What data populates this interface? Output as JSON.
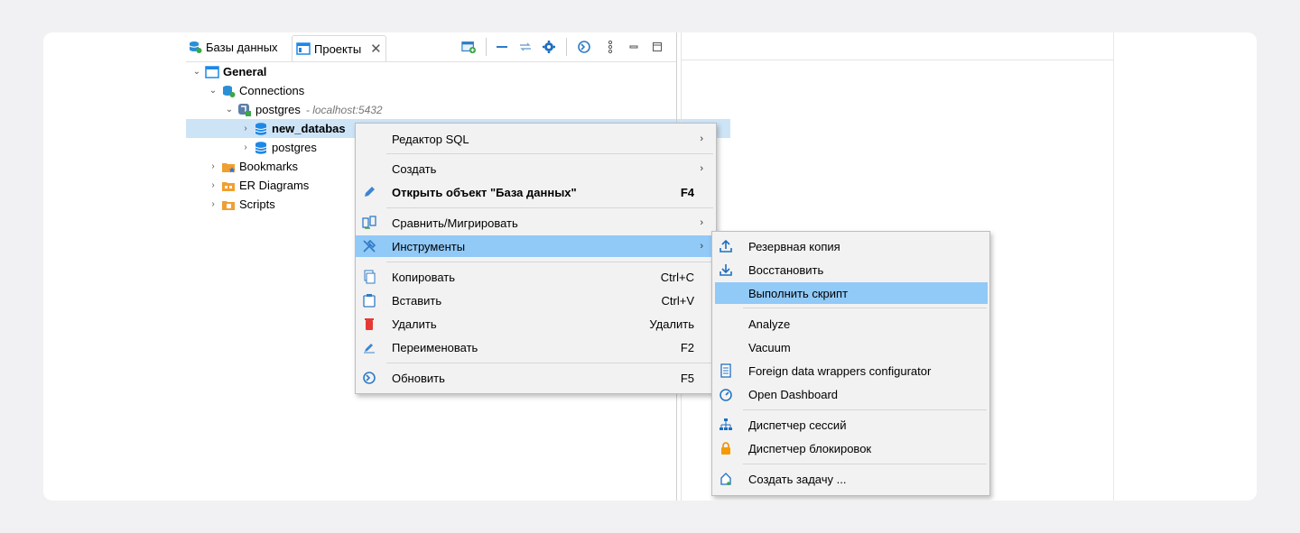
{
  "tabs": [
    {
      "label": "Базы данных",
      "icon": "database-stack-icon"
    },
    {
      "label": "Проекты",
      "icon": "projects-icon"
    }
  ],
  "toolbar": {
    "icons": [
      "new-project-icon",
      "collapse-icon",
      "link-icon",
      "settings-gear-icon",
      "refresh-icon",
      "vertical-dots-icon",
      "minimize-icon",
      "maximize-icon"
    ]
  },
  "tree": {
    "general": "General",
    "connections": "Connections",
    "postgres_conn": "postgres",
    "postgres_host": "- localhost:5432",
    "new_database": "new_databas",
    "postgres_db": "postgres",
    "bookmarks": "Bookmarks",
    "er_diagrams": "ER Diagrams",
    "scripts": "Scripts"
  },
  "context_menu": {
    "items": [
      {
        "label": "Редактор SQL",
        "shortcut": "",
        "submenu": true
      },
      {
        "label": "Создать",
        "shortcut": "",
        "submenu": true
      },
      {
        "label": "Открыть объект \"База данных\"",
        "shortcut": "F4",
        "submenu": false
      },
      {
        "label": "Сравнить/Мигрировать",
        "shortcut": "",
        "submenu": true
      },
      {
        "label": "Инструменты",
        "shortcut": "",
        "submenu": true
      },
      {
        "label": "Копировать",
        "shortcut": "Ctrl+C",
        "submenu": false
      },
      {
        "label": "Вставить",
        "shortcut": "Ctrl+V",
        "submenu": false
      },
      {
        "label": "Удалить",
        "shortcut": "Удалить",
        "submenu": false
      },
      {
        "label": "Переименовать",
        "shortcut": "F2",
        "submenu": false
      },
      {
        "label": "Обновить",
        "shortcut": "F5",
        "submenu": false
      }
    ]
  },
  "tools_submenu": {
    "items": [
      {
        "label": "Резервная копия"
      },
      {
        "label": "Восстановить"
      },
      {
        "label": "Выполнить скрипт"
      },
      {
        "label": "Analyze"
      },
      {
        "label": "Vacuum"
      },
      {
        "label": "Foreign data wrappers configurator"
      },
      {
        "label": "Open Dashboard"
      },
      {
        "label": "Диспетчер сессий"
      },
      {
        "label": "Диспетчер блокировок"
      },
      {
        "label": "Создать задачу ..."
      }
    ]
  },
  "colors": {
    "selection": "#cde4f7",
    "menu_highlight": "#91c9f7",
    "accent_blue": "#1e88e5",
    "folder_orange": "#f0a030"
  }
}
